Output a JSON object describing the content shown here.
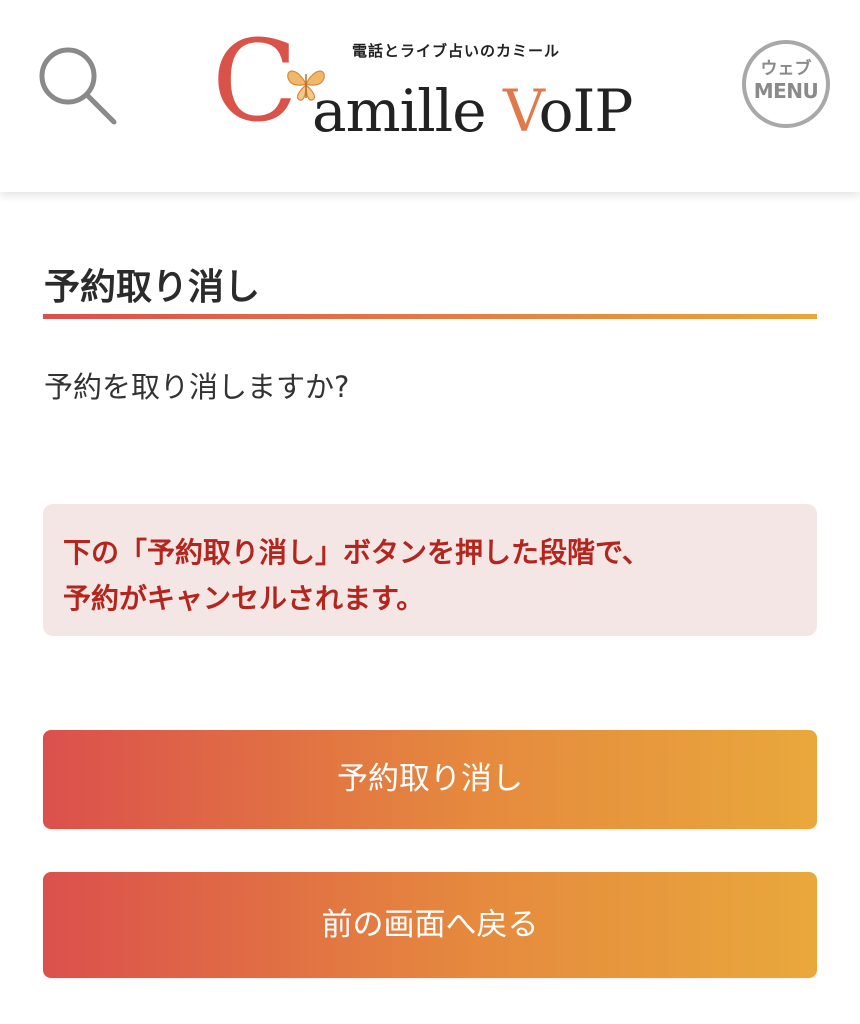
{
  "header": {
    "search_icon": "search-icon",
    "logo": {
      "tagline": "電話とライブ占いのカミール",
      "initial": "C",
      "rest_before_v": "amille ",
      "v": "V",
      "rest_after_v": "oIP",
      "emblem": "butterfly-icon"
    },
    "menu": {
      "line1": "ウェブ",
      "line2": "MENU"
    }
  },
  "main": {
    "title": "予約取り消し",
    "question": "予約を取り消しますか?",
    "notice": {
      "line1": "下の「予約取り消し」ボタンを押した段階で、",
      "line2": "予約がキャンセルされます。"
    },
    "buttons": {
      "cancel_label": "予約取り消し",
      "back_label": "前の画面へ戻る"
    }
  },
  "colors": {
    "accent_start": "#db504c",
    "accent_end": "#e9a83c",
    "notice_bg": "#f5e6e6",
    "notice_text": "#b3261e",
    "logo_c": "#d9534a"
  }
}
